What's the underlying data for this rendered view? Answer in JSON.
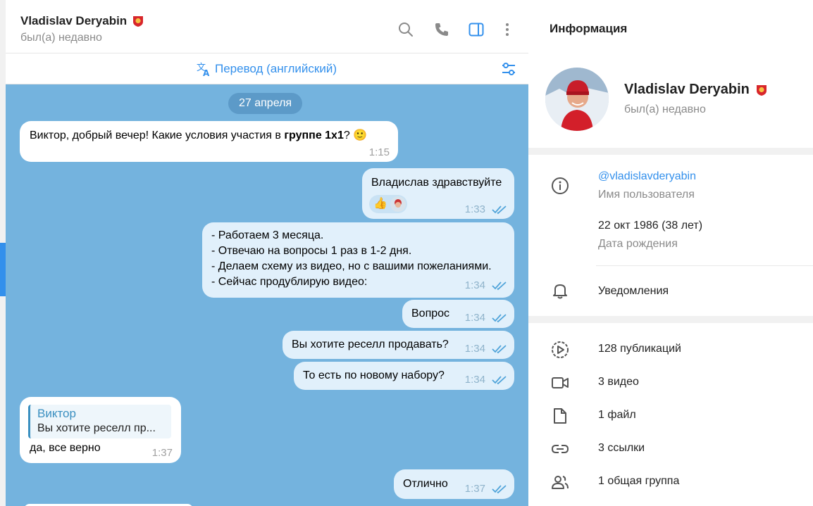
{
  "chat": {
    "contact_name": "Vladislav Deryabin",
    "contact_status": "был(а) недавно",
    "translate_label": "Перевод (английский)",
    "date_chip": "27 апреля",
    "messages": [
      {
        "dir": "in",
        "text_a": "Виктор, добрый вечер! Какие условия участия в ",
        "text_bold": "группе 1x1",
        "text_b": "? ",
        "emoji": "🙂",
        "time": "1:15"
      },
      {
        "dir": "out",
        "text": "Владислав здравствуйте",
        "reaction": "👍",
        "time": "1:33"
      },
      {
        "dir": "out",
        "lines": [
          "- Работаем 3 месяца.",
          "- Отвечаю на вопросы 1 раз в 1-2 дня.",
          "- Делаем схему из видео, но с вашими пожеланиями.",
          "- Сейчас продублирую видео:"
        ],
        "time": "1:34"
      },
      {
        "dir": "out",
        "text": "Вопрос",
        "time": "1:34"
      },
      {
        "dir": "out",
        "text": "Вы хотите реселл продавать?",
        "time": "1:34"
      },
      {
        "dir": "out",
        "text": "То есть по новому набору?",
        "time": "1:34"
      },
      {
        "dir": "in",
        "reply_name": "Виктор",
        "reply_text": "Вы хотите реселл пр...",
        "text": "да, все верно",
        "time": "1:37"
      },
      {
        "dir": "out",
        "text": "Отлично",
        "time": "1:37"
      }
    ]
  },
  "info": {
    "title": "Информация",
    "name": "Vladislav Deryabin",
    "status": "был(а) недавно",
    "username": "@vladislavderyabin",
    "username_label": "Имя пользователя",
    "birthday": "22 окт 1986 (38 лет)",
    "birthday_label": "Дата рождения",
    "notifications_label": "Уведомления",
    "media": [
      {
        "icon": "posts-icon",
        "label": "128 публикаций"
      },
      {
        "icon": "video-icon",
        "label": "3 видео"
      },
      {
        "icon": "file-icon",
        "label": "1 файл"
      },
      {
        "icon": "link-icon",
        "label": "3 ссылки"
      },
      {
        "icon": "group-icon",
        "label": "1 общая группа"
      }
    ]
  },
  "colors": {
    "accent": "#3390ec",
    "chat_bg": "#74b3de",
    "out_bubble": "#e1f0fb",
    "date_chip": "#5c9ac8"
  }
}
